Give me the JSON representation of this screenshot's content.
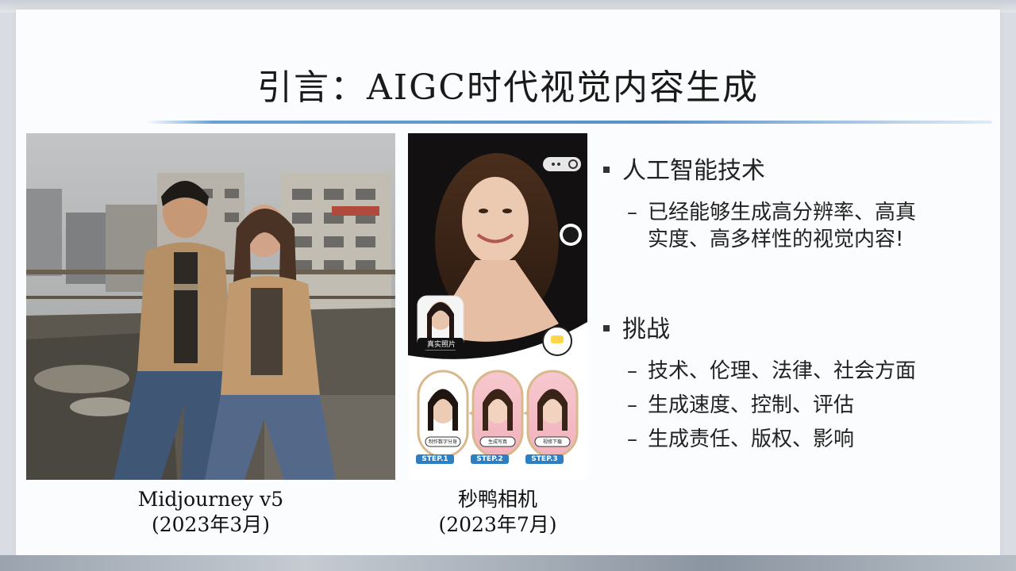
{
  "slide": {
    "title": "引言：AIGC时代视觉内容生成",
    "images": [
      {
        "caption_line1": "Midjourney v5",
        "caption_line2": "(2023年3月)"
      },
      {
        "caption_line1": "秒鸭相机",
        "caption_line2": "(2023年7月)",
        "inset_label": "真实照片",
        "steps": [
          {
            "label": "制作数字分身",
            "step": "STEP.1"
          },
          {
            "label": "生成写真",
            "step": "STEP.2"
          },
          {
            "label": "视修下载",
            "step": "STEP.3"
          }
        ]
      }
    ],
    "bullets": [
      {
        "heading": "人工智能技术",
        "items": [
          "已经能够生成高分辨率、高真",
          "实度、高多样性的视觉内容!"
        ]
      },
      {
        "heading": "挑战",
        "items": [
          "技术、伦理、法律、社会方面",
          "生成速度、控制、评估",
          "生成责任、版权、影响"
        ]
      }
    ]
  },
  "colors": {
    "accent_rule": "#5a8fc8",
    "text": "#1a1a1a",
    "step_pink": "#f3b6c0"
  }
}
